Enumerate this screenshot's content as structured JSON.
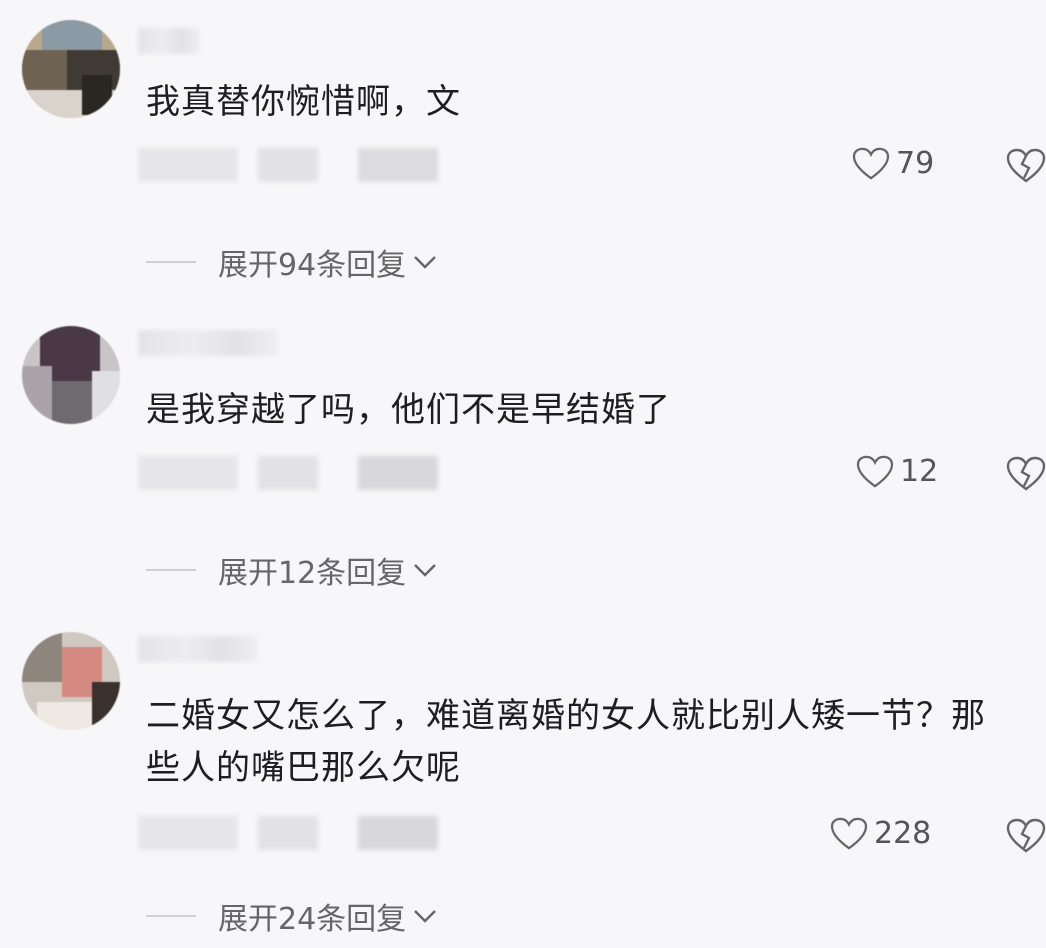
{
  "comments": [
    {
      "text": "我真替你惋惜啊，文",
      "likes": "79",
      "expand_label": "展开94条回复"
    },
    {
      "text": "是我穿越了吗，他们不是早结婚了",
      "likes": "12",
      "expand_label": "展开12条回复"
    },
    {
      "text": "二婚女又怎么了，难道离婚的女人就比别人矮一节？那些人的嘴巴那么欠呢",
      "likes": "228",
      "expand_label": "展开24条回复"
    }
  ],
  "icons": {
    "like": "heart-outline-icon",
    "dislike": "broken-heart-icon",
    "expand": "chevron-down-icon"
  },
  "colors": {
    "background": "#f7f7f9",
    "text": "#1e1e1e",
    "secondary": "#666666"
  }
}
